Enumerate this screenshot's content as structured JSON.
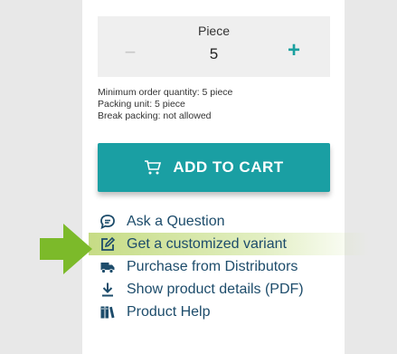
{
  "quantity": {
    "label": "Piece",
    "value": "5",
    "minus": "−",
    "plus": "+"
  },
  "info": {
    "min_order": "Minimum order quantity: 5 piece",
    "packing_unit": "Packing unit: 5 piece",
    "break_packing": "Break packing: not allowed"
  },
  "cart": {
    "label": "ADD TO CART",
    "icon": "cart-icon"
  },
  "links": [
    {
      "label": "Ask a Question",
      "icon": "chat-icon"
    },
    {
      "label": "Get a customized variant",
      "icon": "edit-icon"
    },
    {
      "label": "Purchase from Distributors",
      "icon": "truck-icon"
    },
    {
      "label": "Show product details (PDF)",
      "icon": "download-icon"
    },
    {
      "label": "Product Help",
      "icon": "books-icon"
    }
  ],
  "colors": {
    "accent": "#1a9fa3",
    "link": "#1d4c6b",
    "highlight": "#c0d878",
    "arrow": "#7cba2a"
  }
}
